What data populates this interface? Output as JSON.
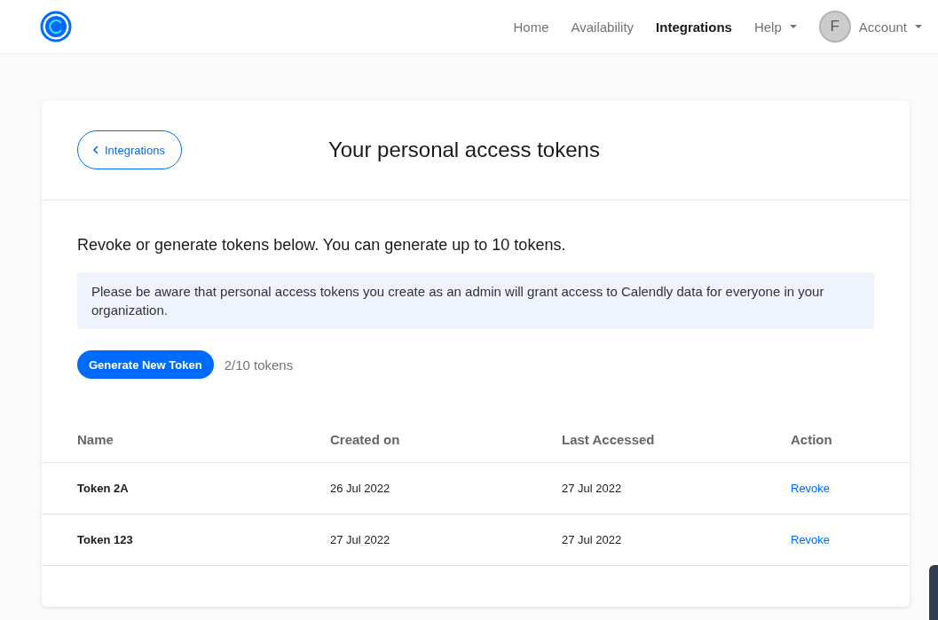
{
  "nav": {
    "items": [
      {
        "label": "Home",
        "selected": false,
        "dropdown": false
      },
      {
        "label": "Availability",
        "selected": false,
        "dropdown": false
      },
      {
        "label": "Integrations",
        "selected": true,
        "dropdown": false
      },
      {
        "label": "Help",
        "selected": false,
        "dropdown": true
      }
    ],
    "avatar": "F",
    "account": "Account"
  },
  "page": {
    "back_button": "Integrations",
    "title": "Your personal access tokens"
  },
  "intro": "Revoke or generate tokens below. You can generate up to 10 tokens.",
  "notice": "Please be aware that personal access tokens you create as an admin will grant access to Calendly data for everyone in your organization.",
  "generate_button": "Generate New Token",
  "token_count": "2/10 tokens",
  "table": {
    "columns": [
      "Name",
      "Created on",
      "Last Accessed",
      "Action"
    ],
    "rows": [
      {
        "name": "Token 2A",
        "created": "26 Jul 2022",
        "accessed": "27 Jul 2022",
        "action": "Revoke"
      },
      {
        "name": "Token 123",
        "created": "27 Jul 2022",
        "accessed": "27 Jul 2022",
        "action": "Revoke"
      }
    ]
  }
}
